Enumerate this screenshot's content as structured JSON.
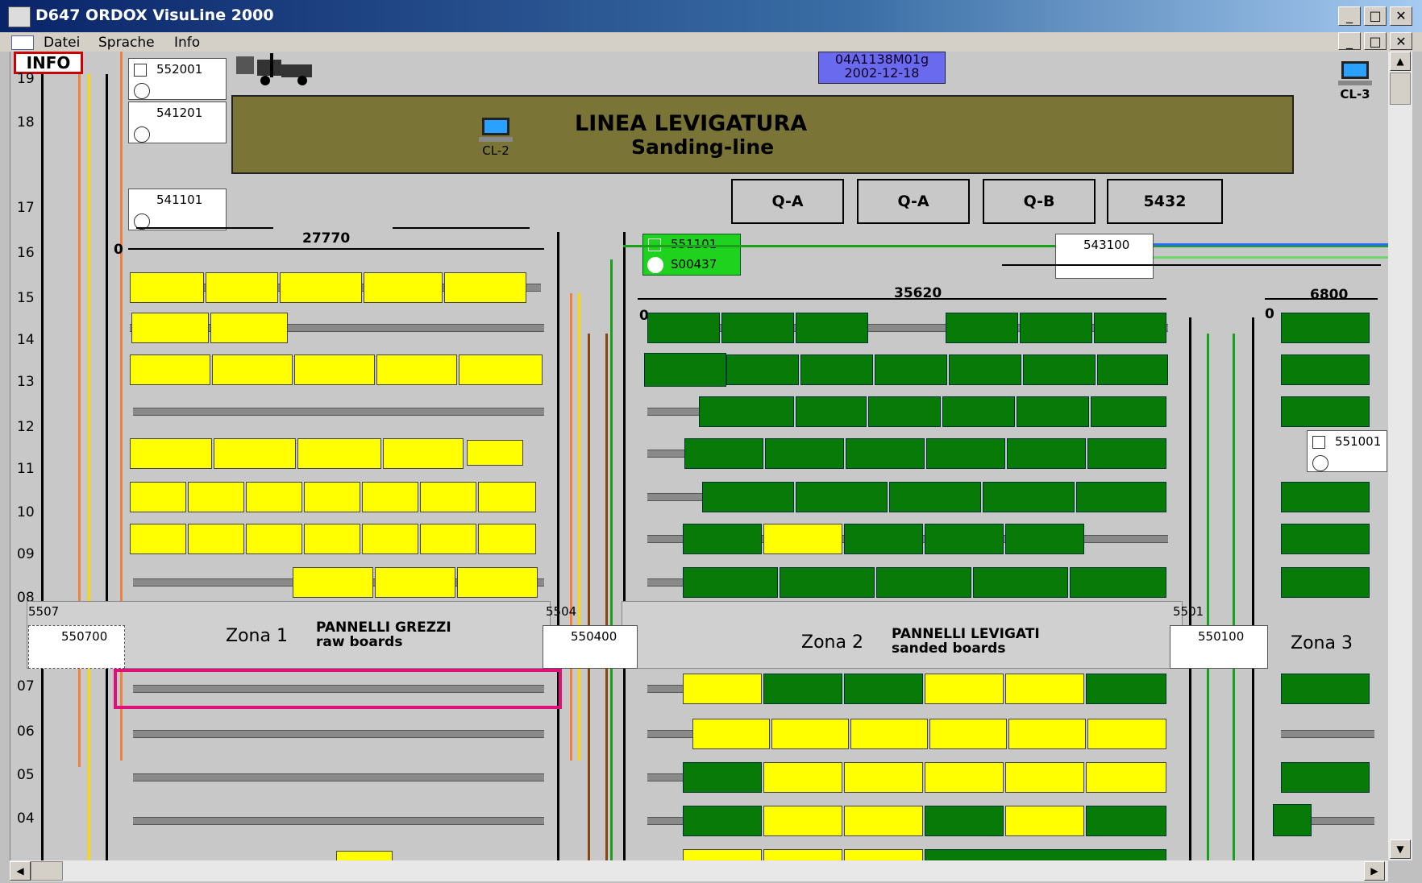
{
  "window": {
    "title": "D647 ORDOX VisuLine 2000",
    "min": "_",
    "max": "□",
    "close": "✕"
  },
  "menu": [
    "Datei",
    "Sprache",
    "Info"
  ],
  "info_label": "INFO",
  "version_box": {
    "line1": "04A1138M01g",
    "line2": "2002-12-18"
  },
  "banner": {
    "title": "LINEA LEVIGATURA",
    "subtitle": "Sanding-line"
  },
  "terminals": {
    "cl2": "CL-2",
    "cl3": "CL-3"
  },
  "qc_boxes": [
    "Q-A",
    "Q-A",
    "Q-B",
    "5432"
  ],
  "row_labels": [
    "19",
    "18",
    "17",
    "16",
    "15",
    "14",
    "13",
    "12",
    "11",
    "10",
    "09",
    "08",
    "07",
    "06",
    "05",
    "04"
  ],
  "sensors": {
    "s1": "552001",
    "s2": "541201",
    "s3": "541101",
    "s4": "551101",
    "s5": "S00437",
    "s6": "543100",
    "s7": "551001",
    "s8": "550700",
    "s9": "550400",
    "s10": "550100"
  },
  "stations": {
    "a": "5507",
    "b": "5504",
    "c": "5501"
  },
  "dimensions": {
    "d1_zero": "0",
    "d1": "27770",
    "d2_zero": "0",
    "d2": "35620",
    "d3_zero": "0",
    "d3": "6800"
  },
  "zones": {
    "z1": {
      "name": "Zona 1",
      "it": "PANNELLI GREZZI",
      "en": "raw boards"
    },
    "z2": {
      "name": "Zona 2",
      "it": "PANNELLI LEVIGATI",
      "en": "sanded boards"
    },
    "z3": {
      "name": "Zona 3"
    }
  },
  "colors": {
    "raw_board": "#ffff00",
    "sanded_board": "#087a08",
    "highlight": "#e0107a",
    "banner": "#7a7436"
  }
}
